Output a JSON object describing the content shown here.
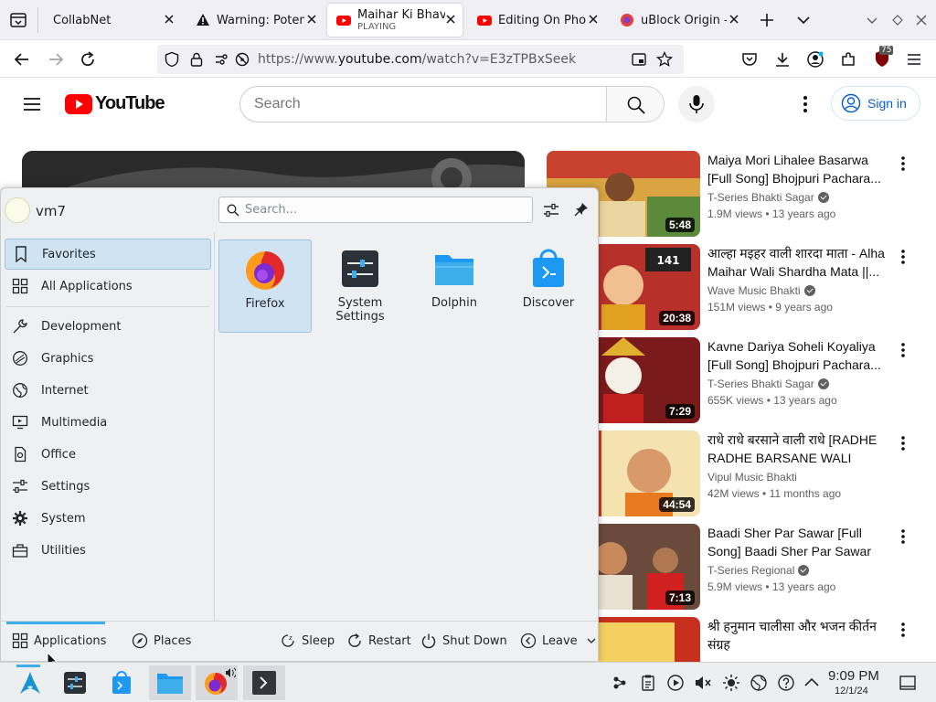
{
  "browser": {
    "tabs": [
      {
        "title": "CollabNet",
        "subtitle": ""
      },
      {
        "title": "Warning: Poten",
        "subtitle": ""
      },
      {
        "title": "Maihar Ki Bhav",
        "subtitle": "PLAYING"
      },
      {
        "title": "Editing On Pho",
        "subtitle": ""
      },
      {
        "title": "uBlock Origin -",
        "subtitle": ""
      }
    ],
    "url_prefix": "https://www.",
    "url_domain": "youtube.com",
    "url_path": "/watch?v=E3zTPBxSeek",
    "extension_badge": "75"
  },
  "youtube": {
    "logo_text": "YouTube",
    "search_placeholder": "Search",
    "sign_in": "Sign in",
    "recommendations": [
      {
        "title": "Maiya Mori Lihalee Basarwa [Full Song] Bhojpuri Pachara...",
        "channel": "T-Series Bhakti Sagar",
        "verified": true,
        "views": "1.9M views",
        "age": "13 years ago",
        "duration": "5:48"
      },
      {
        "title": "आल्हा मइहर वाली शारदा माता - Alha Maihar Wali Shardha Mata ||...",
        "channel": "Wave Music Bhakti",
        "verified": true,
        "views": "151M views",
        "age": "9 years ago",
        "duration": "20:38"
      },
      {
        "title": "Kavne Dariya Soheli Koyaliya [Full Song] Bhojpuri Pachara...",
        "channel": "T-Series Bhakti Sagar",
        "verified": true,
        "views": "655K views",
        "age": "13 years ago",
        "duration": "7:29"
      },
      {
        "title": "राधे राधे बरसाने वाली राधे [RADHE RADHE BARSANE WALI RADH...",
        "channel": "Vipul Music Bhakti",
        "verified": false,
        "views": "42M views",
        "age": "11 months ago",
        "duration": "44:54"
      },
      {
        "title": "Baadi Sher Par Sawar [Full Song] Baadi Sher Par Sawar",
        "channel": "T-Series Regional",
        "verified": true,
        "views": "5.9M views",
        "age": "13 years ago",
        "duration": "7:13"
      },
      {
        "title": "श्री हनुमान चालीसा और भजन कीर्तन संग्रह",
        "channel": "",
        "verified": false,
        "views": "",
        "age": "",
        "duration": ""
      }
    ]
  },
  "launcher": {
    "user": "vm7",
    "search_placeholder": "Search...",
    "categories": [
      "Favorites",
      "All Applications",
      "Development",
      "Graphics",
      "Internet",
      "Multimedia",
      "Office",
      "Settings",
      "System",
      "Utilities"
    ],
    "category_icons": [
      "bookmark-icon",
      "grid-icon",
      "tools-icon",
      "palette-icon",
      "globe-icon",
      "monitor-icon",
      "document-icon",
      "sliders-icon",
      "gear-icon",
      "toolbox-icon"
    ],
    "favorites": [
      {
        "name": "Firefox",
        "icon": "firefox-icon"
      },
      {
        "name": "System Settings",
        "icon": "settings-icon"
      },
      {
        "name": "Dolphin",
        "icon": "folder-icon"
      },
      {
        "name": "Discover",
        "icon": "store-icon"
      }
    ],
    "footer": {
      "applications": "Applications",
      "places": "Places",
      "sleep": "Sleep",
      "restart": "Restart",
      "shutdown": "Shut Down",
      "leave": "Leave"
    }
  },
  "taskbar": {
    "time": "9:09 PM",
    "date": "12/1/24"
  },
  "colors": {
    "accent": "#3daee9",
    "selection": "#cfe3f3",
    "youtube_red": "#ff0000",
    "link_blue": "#065fd4"
  }
}
